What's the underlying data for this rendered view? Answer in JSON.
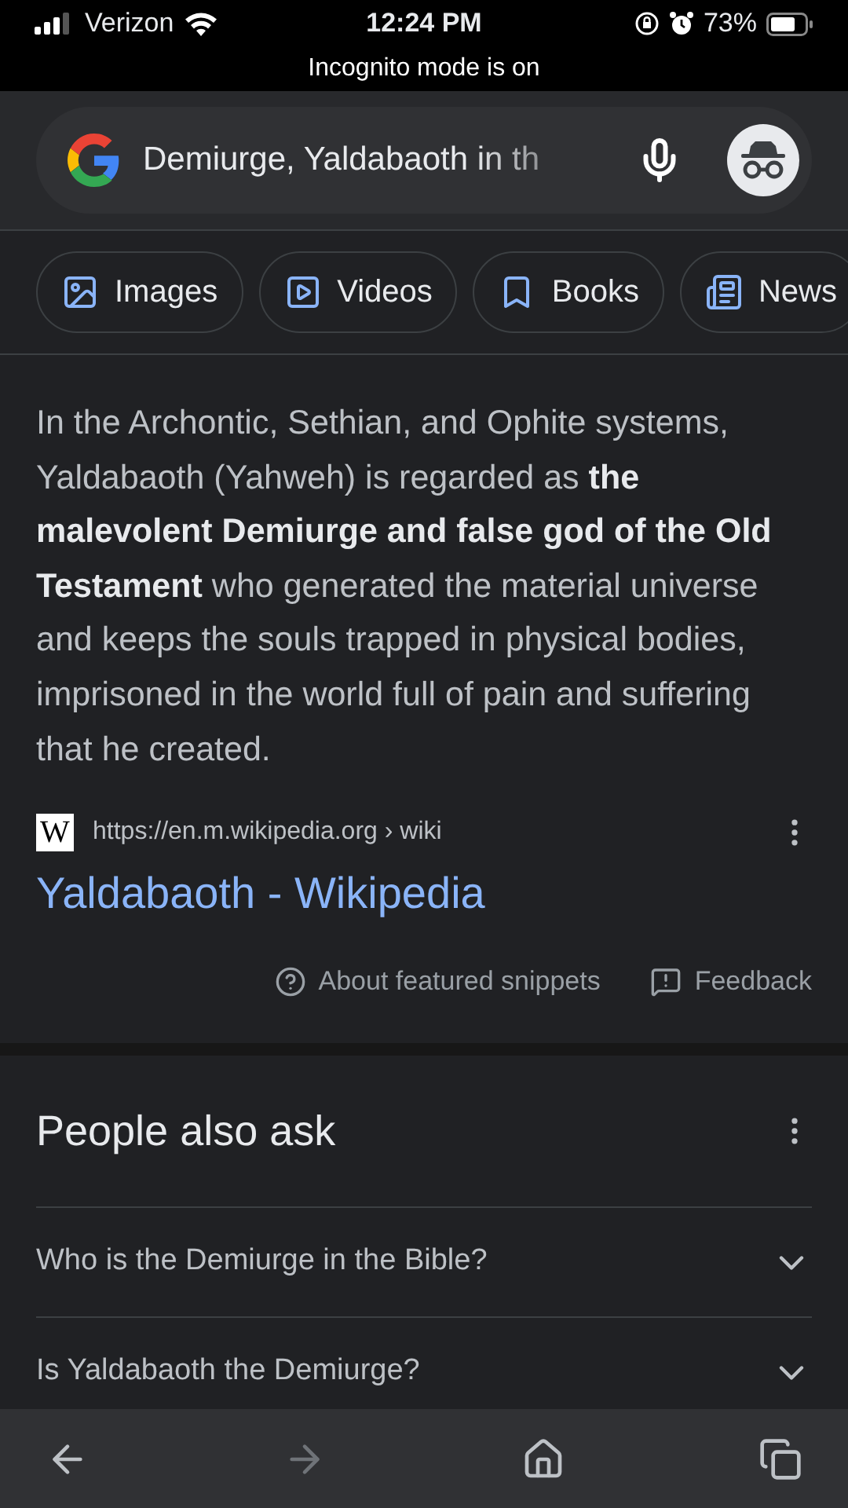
{
  "status_bar": {
    "carrier": "Verizon",
    "time": "12:24 PM",
    "battery": "73%"
  },
  "incognito_banner": "Incognito mode is on",
  "search": {
    "value": "Demiurge, Yaldabaoth in th"
  },
  "chips": [
    {
      "kind": "images",
      "label": "Images"
    },
    {
      "kind": "videos",
      "label": "Videos"
    },
    {
      "kind": "books",
      "label": "Books"
    },
    {
      "kind": "news",
      "label": "News"
    }
  ],
  "snippet": {
    "text": "In the Archontic, Sethian, and Ophite systems, Yaldabaoth (Yahweh) is regarded as **the malevolent Demiurge and false god of the Old Testament** who generated the material universe and keeps the souls trapped in physical bodies, imprisoned in the world full of pain and suffering that he created.",
    "site_icon": "W",
    "url": "https://en.m.wikipedia.org",
    "path": "› wiki",
    "title": "Yaldabaoth - Wikipedia",
    "about": "About featured snippets",
    "feedback": "Feedback"
  },
  "people_also_ask": {
    "title": "People also ask",
    "questions": [
      {
        "text": "Who is the Demiurge in the Bible?",
        "expanded": false
      },
      {
        "text": "Is Yaldabaoth the Demiurge?",
        "expanded": false
      }
    ]
  },
  "bottom_bar": [
    {
      "kind": "back",
      "disabled": false
    },
    {
      "kind": "forward",
      "disabled": true
    },
    {
      "kind": "home",
      "disabled": false
    },
    {
      "kind": "tabs",
      "disabled": false
    }
  ]
}
